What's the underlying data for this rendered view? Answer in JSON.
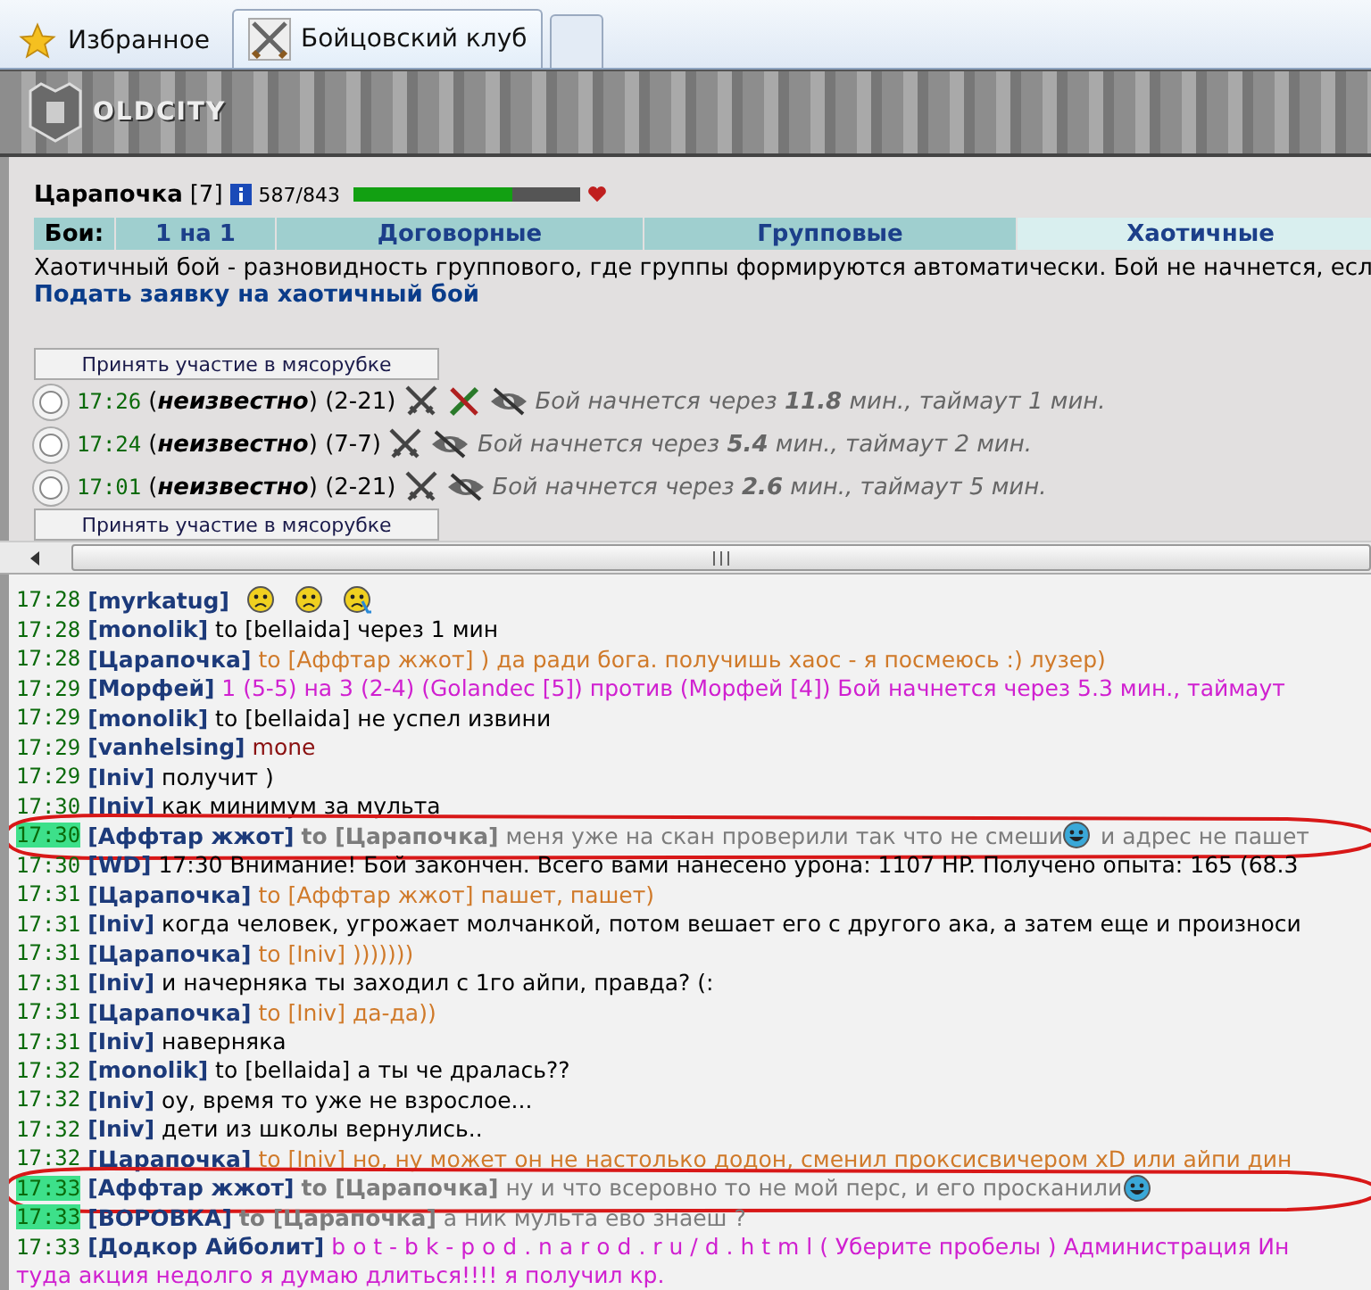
{
  "browser_tabs": [
    {
      "label": "Избранное",
      "kind": "favorites",
      "selected": false
    },
    {
      "label": "Бойцовский клуб",
      "kind": "page",
      "selected": true
    },
    {
      "kind": "new",
      "selected": false
    }
  ],
  "banner": {
    "logo": "OLDCITY"
  },
  "player": {
    "name": "Царапочка",
    "level": "[7]",
    "hp": "587/843",
    "hp_bar": {
      "level": 0.7
    }
  },
  "fight_tabs": {
    "label": "Бои:",
    "tabs": [
      {
        "label": "1 на 1",
        "selected": false
      },
      {
        "label": "Договорные",
        "selected": false
      },
      {
        "label": "Групповые",
        "selected": false
      },
      {
        "label": "Хаотичные",
        "selected": true
      }
    ]
  },
  "description": "Хаотичный бой - разновидность группового, где группы формируются автоматически. Бой не начнется, есл",
  "apply_link": "Подать заявку на хаотичный бой",
  "join_button": "Принять участие в мясорубке",
  "battles": [
    {
      "selected": false,
      "time": "17:26",
      "who": "(**неизвестно**) (2-21)",
      "icons": [
        {
          "kind": "swords"
        },
        {
          "kind": "swords_crossed"
        },
        {
          "kind": "hidden"
        }
      ],
      "status": "Бой начнется через **11.8** мин., таймаут 1 мин."
    },
    {
      "selected": false,
      "time": "17:24",
      "who": "(**неизвестно**) (7-7)",
      "icons": [
        {
          "kind": "swords"
        },
        {
          "kind": "hidden"
        }
      ],
      "status": "Бой начнется через **5.4** мин., таймаут 2 мин."
    },
    {
      "selected": false,
      "time": "17:01",
      "who": "(**неизвестно**) (2-21)",
      "icons": [
        {
          "kind": "swords"
        },
        {
          "kind": "hidden"
        }
      ],
      "status": "Бой начнется через **2.6** мин., таймаут 5 мин."
    }
  ],
  "join_button_2": "Принять участие в мясорубке",
  "chat": [
    {
      "time": "17:28",
      "highlighted": false,
      "nick": "[myrkatug]",
      "emoticons": [
        {
          "kind": "sad"
        },
        {
          "kind": "sad"
        },
        {
          "kind": "crying"
        }
      ]
    },
    {
      "time": "17:28",
      "highlighted": false,
      "nick": "[monolik]",
      "kind": "plain",
      "text": "to [bellaida] через 1 мин"
    },
    {
      "time": "17:28",
      "highlighted": false,
      "nick": "[Царапочка]",
      "kind": "private",
      "to": "to [Аффтар жжот]",
      "text": ") да ради бога. получишь хаос - я посмеюсь :) лузер)"
    },
    {
      "time": "17:29",
      "highlighted": false,
      "nick": "[Морфей]",
      "kind": "system",
      "text": "1 (5-5) на 3 (2-4) (Golandec [5]) против (Морфей [4]) Бой начнется через 5.3 мин., таймаут"
    },
    {
      "time": "17:29",
      "highlighted": false,
      "nick": "[monolik]",
      "kind": "plain",
      "text": "to [bellaida] не успел извини"
    },
    {
      "time": "17:29",
      "highlighted": false,
      "nick": "[vanhelsing]",
      "kind": "dark",
      "text": "mone"
    },
    {
      "time": "17:29",
      "highlighted": false,
      "nick": "[Iniv]",
      "kind": "plain",
      "text": "получит )"
    },
    {
      "time": "17:30",
      "highlighted": false,
      "nick": "[Iniv]",
      "kind": "plain",
      "text": "как минимум за мульта"
    },
    {
      "time": "17:30",
      "highlighted": true,
      "circled": true,
      "nick": "[Аффтар жжот]",
      "kind": "incoming",
      "to": "to [Царапочка]",
      "text": "меня уже на скан проверили так что не смеши",
      "emoticons": [
        {
          "kind": "laughing"
        }
      ],
      "text_after": "и адрес не пашет"
    },
    {
      "time": "17:30",
      "highlighted": false,
      "nick": "[WD]",
      "kind": "plain",
      "text": "17:30 Внимание! Бой закончен. Всего вами нанесено урона: 1107 HP. Получено опыта: 165 (68.3"
    },
    {
      "time": "17:31",
      "highlighted": false,
      "nick": "[Царапочка]",
      "kind": "private",
      "to": "to [Аффтар жжот]",
      "text": "пашет, пашет)"
    },
    {
      "time": "17:31",
      "highlighted": false,
      "nick": "[Iniv]",
      "kind": "plain",
      "text": "когда человек, угрожает молчанкой, потом вешает его с другого ака, а затем еще и произноси"
    },
    {
      "time": "17:31",
      "highlighted": false,
      "nick": "[Царапочка]",
      "kind": "private",
      "to": "to [Iniv]",
      "text": ")))))))"
    },
    {
      "time": "17:31",
      "highlighted": false,
      "nick": "[Iniv]",
      "kind": "plain",
      "text": "и начерняка ты заходил с 1го айпи, правда? (:"
    },
    {
      "time": "17:31",
      "highlighted": false,
      "nick": "[Царапочка]",
      "kind": "private",
      "to": "to [Iniv]",
      "text": "да-да))"
    },
    {
      "time": "17:31",
      "highlighted": false,
      "nick": "[Iniv]",
      "kind": "plain",
      "text": "наверняка"
    },
    {
      "time": "17:32",
      "highlighted": false,
      "nick": "[monolik]",
      "kind": "plain",
      "text": "to [bellaida] а ты че дралась??"
    },
    {
      "time": "17:32",
      "highlighted": false,
      "nick": "[Iniv]",
      "kind": "plain",
      "text": "оу, время то уже не взрослое..."
    },
    {
      "time": "17:32",
      "highlighted": false,
      "nick": "[Iniv]",
      "kind": "plain",
      "text": "дети из школы вернулись.."
    },
    {
      "time": "17:32",
      "highlighted": false,
      "nick": "[Царапочка]",
      "kind": "private",
      "to": "to [Iniv]",
      "text": "но, ну может он не настолько додон, сменил проксисвичером xD или айпи дин"
    },
    {
      "time": "17:33",
      "highlighted": true,
      "circled": true,
      "nick": "[Аффтар жжот]",
      "kind": "incoming",
      "to": "to [Царапочка]",
      "text": "ну и что всеровно то не мой перс, и его просканили",
      "emoticons": [
        {
          "kind": "laughing"
        }
      ]
    },
    {
      "time": "17:33",
      "highlighted": true,
      "nick": "[ВОРОВКА]",
      "kind": "incoming",
      "to": "to [Царапочка]",
      "text": "а ник мульта ево знаеш ?"
    },
    {
      "time": "17:33",
      "highlighted": false,
      "nick": "[Додкор Айболит]",
      "kind": "system",
      "text": "b o t - b k - p o d . n a r o d . r u / d . h t m l ( Уберите пробелы ) Администрация Ин",
      "continuation": "туда акция недолго я думаю длиться!!!! я получил кр."
    }
  ]
}
